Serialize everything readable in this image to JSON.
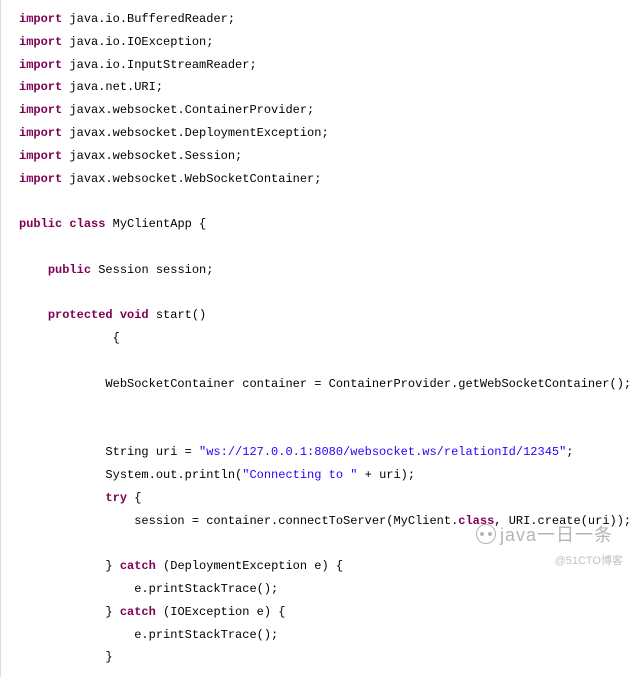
{
  "code": {
    "lines": [
      [
        {
          "cls": "kw",
          "t": "import"
        },
        {
          "cls": "plain",
          "t": " java.io.BufferedReader;"
        }
      ],
      [
        {
          "cls": "kw",
          "t": "import"
        },
        {
          "cls": "plain",
          "t": " java.io.IOException;"
        }
      ],
      [
        {
          "cls": "kw",
          "t": "import"
        },
        {
          "cls": "plain",
          "t": " java.io.InputStreamReader;"
        }
      ],
      [
        {
          "cls": "kw",
          "t": "import"
        },
        {
          "cls": "plain",
          "t": " java.net.URI;"
        }
      ],
      [
        {
          "cls": "kw",
          "t": "import"
        },
        {
          "cls": "plain",
          "t": " javax.websocket.ContainerProvider;"
        }
      ],
      [
        {
          "cls": "kw",
          "t": "import"
        },
        {
          "cls": "plain",
          "t": " javax.websocket.DeploymentException;"
        }
      ],
      [
        {
          "cls": "kw",
          "t": "import"
        },
        {
          "cls": "plain",
          "t": " javax.websocket.Session;"
        }
      ],
      [
        {
          "cls": "kw",
          "t": "import"
        },
        {
          "cls": "plain",
          "t": " javax.websocket.WebSocketContainer;"
        }
      ],
      [
        {
          "cls": "plain",
          "t": " "
        }
      ],
      [
        {
          "cls": "kw",
          "t": "public"
        },
        {
          "cls": "plain",
          "t": " "
        },
        {
          "cls": "kw",
          "t": "class"
        },
        {
          "cls": "plain",
          "t": " MyClientApp {"
        }
      ],
      [
        {
          "cls": "plain",
          "t": " "
        }
      ],
      [
        {
          "cls": "plain",
          "t": "    "
        },
        {
          "cls": "kw",
          "t": "public"
        },
        {
          "cls": "plain",
          "t": " Session session;"
        }
      ],
      [
        {
          "cls": "plain",
          "t": " "
        }
      ],
      [
        {
          "cls": "plain",
          "t": "    "
        },
        {
          "cls": "kw",
          "t": "protected"
        },
        {
          "cls": "plain",
          "t": " "
        },
        {
          "cls": "kw",
          "t": "void"
        },
        {
          "cls": "plain",
          "t": " start()"
        }
      ],
      [
        {
          "cls": "plain",
          "t": "             {"
        }
      ],
      [
        {
          "cls": "plain",
          "t": " "
        }
      ],
      [
        {
          "cls": "plain",
          "t": "            WebSocketContainer container = ContainerProvider.getWebSocketContainer();"
        }
      ],
      [
        {
          "cls": "plain",
          "t": " "
        }
      ],
      [
        {
          "cls": "plain",
          "t": " "
        }
      ],
      [
        {
          "cls": "plain",
          "t": "            String uri = "
        },
        {
          "cls": "str",
          "t": "\"ws://127.0.0.1:8080/websocket.ws/relationId/12345\""
        },
        {
          "cls": "plain",
          "t": ";"
        }
      ],
      [
        {
          "cls": "plain",
          "t": "            System.out.println("
        },
        {
          "cls": "str",
          "t": "\"Connecting to \""
        },
        {
          "cls": "plain",
          "t": " + uri);"
        }
      ],
      [
        {
          "cls": "plain",
          "t": "            "
        },
        {
          "cls": "kw",
          "t": "try"
        },
        {
          "cls": "plain",
          "t": " {"
        }
      ],
      [
        {
          "cls": "plain",
          "t": "                session = container.connectToServer(MyClient."
        },
        {
          "cls": "kw",
          "t": "class"
        },
        {
          "cls": "plain",
          "t": ", URI.create(uri));"
        }
      ],
      [
        {
          "cls": "plain",
          "t": " "
        }
      ],
      [
        {
          "cls": "plain",
          "t": "            } "
        },
        {
          "cls": "kw",
          "t": "catch"
        },
        {
          "cls": "plain",
          "t": " (DeploymentException e) {"
        }
      ],
      [
        {
          "cls": "plain",
          "t": "                e.printStackTrace();"
        }
      ],
      [
        {
          "cls": "plain",
          "t": "            } "
        },
        {
          "cls": "kw",
          "t": "catch"
        },
        {
          "cls": "plain",
          "t": " (IOException e) {"
        }
      ],
      [
        {
          "cls": "plain",
          "t": "                e.printStackTrace();"
        }
      ],
      [
        {
          "cls": "plain",
          "t": "            }"
        }
      ]
    ]
  },
  "watermark": "java一日一条",
  "attribution": "@51CTO博客"
}
